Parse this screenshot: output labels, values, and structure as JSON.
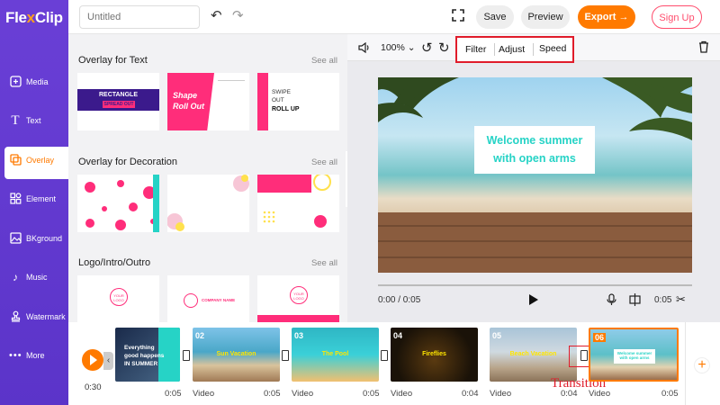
{
  "app": {
    "logo_part1": "Fle",
    "logo_x": "x",
    "logo_part2": "Clip"
  },
  "topbar": {
    "title_placeholder": "Untitled",
    "save": "Save",
    "preview": "Preview",
    "export": "Export",
    "signup": "Sign Up"
  },
  "sidebar": {
    "items": [
      {
        "label": "Media"
      },
      {
        "label": "Text"
      },
      {
        "label": "Overlay"
      },
      {
        "label": "Element"
      },
      {
        "label": "BKground"
      },
      {
        "label": "Music"
      },
      {
        "label": "Watermark"
      },
      {
        "label": "More"
      }
    ]
  },
  "panel": {
    "sections": [
      {
        "title": "Overlay for Text",
        "see_all": "See all"
      },
      {
        "title": "Overlay for Decoration",
        "see_all": "See all"
      },
      {
        "title": "Logo/Intro/Outro",
        "see_all": "See all"
      }
    ],
    "text_thumbs": [
      "RECTANGLE",
      "SPREAD OUT",
      "Shape",
      "Roll Out",
      "SWIPE",
      "OUT",
      "ROLL UP"
    ],
    "logo_thumbs": [
      "YOUR LOGO",
      "COMPANY NAME",
      "YOUR LOGO"
    ]
  },
  "preview": {
    "zoom": "100%",
    "tabs": [
      "Filter",
      "Adjust",
      "Speed"
    ],
    "caption_line1": "Welcome summer",
    "caption_line2": "with open arms",
    "time": "0:00 / 0:05",
    "duration": "0:05"
  },
  "timeline": {
    "current_time": "0:30",
    "clips": [
      {
        "num": "",
        "title": "Everything good happens IN SUMMER",
        "type": "",
        "duration": "0:05"
      },
      {
        "num": "02",
        "title": "Sun Vacation",
        "type": "Video",
        "duration": "0:05"
      },
      {
        "num": "03",
        "title": "The Pool",
        "type": "Video",
        "duration": "0:05"
      },
      {
        "num": "04",
        "title": "Fireflies",
        "type": "Video",
        "duration": "0:04"
      },
      {
        "num": "05",
        "title": "Beach Vacation",
        "type": "Video",
        "duration": "0:04"
      },
      {
        "num": "06",
        "title": "Welcome summer with open arms",
        "type": "Video",
        "duration": "0:05"
      }
    ],
    "transition_label": "Transition"
  },
  "colors": {
    "sidebar": "#6a3fd6",
    "accent": "#ff7a00",
    "highlight": "#e01c2b",
    "signup": "#ff4d6d"
  }
}
